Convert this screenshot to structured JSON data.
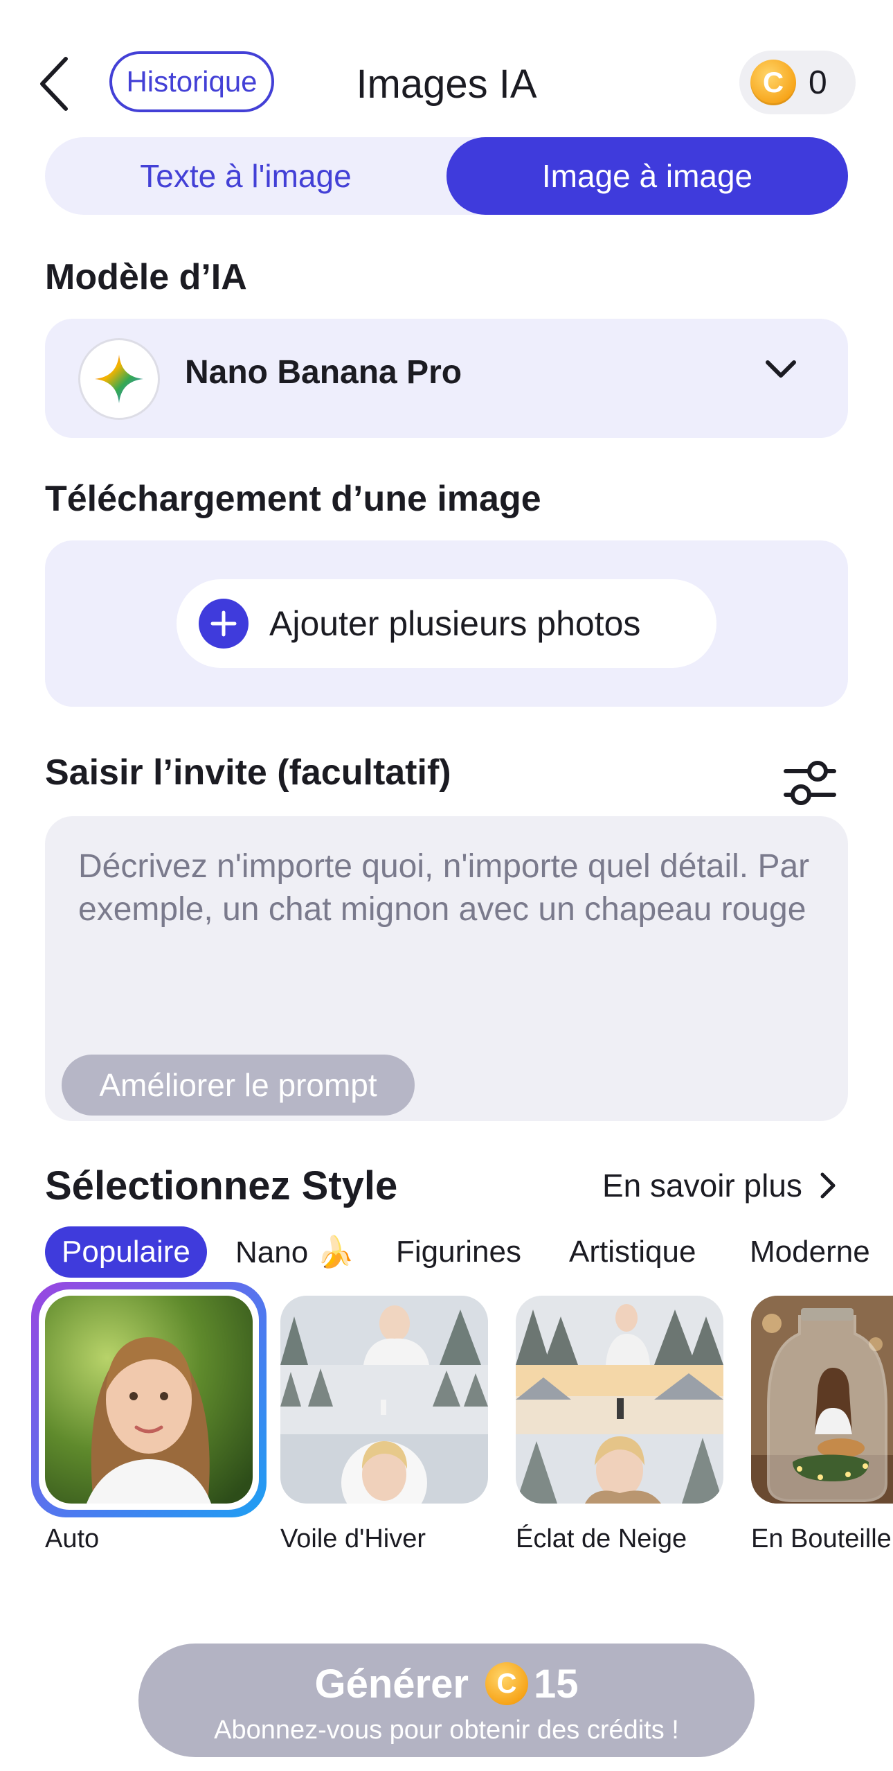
{
  "header": {
    "back_icon": "chevron-left-icon",
    "history_label": "Historique",
    "title": "Images IA",
    "coin_glyph": "C",
    "credits": "0"
  },
  "tabs": [
    {
      "label": "Texte à l'image",
      "active": false
    },
    {
      "label": "Image à image",
      "active": true
    }
  ],
  "model": {
    "section_label": "Modèle d’IA",
    "name": "Nano Banana Pro",
    "icon": "sparkle-icon"
  },
  "upload": {
    "section_label": "Téléchargement d’une image",
    "button_label": "Ajouter plusieurs photos"
  },
  "prompt": {
    "section_label": "Saisir l’invite (facultatif)",
    "placeholder": "Décrivez n'importe quoi, n'importe quel détail. Par exemple, un chat mignon avec un chapeau rouge",
    "value": "",
    "improve_label": "Améliorer le prompt"
  },
  "style": {
    "title": "Sélectionnez Style",
    "learn_more": "En savoir plus",
    "categories": [
      "Populaire",
      "Nano 🍌",
      "Figurines",
      "Artistique",
      "Moderne"
    ],
    "active_category": "Populaire",
    "items": [
      {
        "name": "Auto",
        "selected": true
      },
      {
        "name": "Voile d'Hiver",
        "selected": false
      },
      {
        "name": "Éclat de Neige",
        "selected": false
      },
      {
        "name": "En Bouteille",
        "selected": false
      }
    ]
  },
  "generate": {
    "label": "Générer",
    "coin_glyph": "C",
    "cost": "15",
    "subtitle": "Abonnez-vous pour obtenir des crédits !"
  },
  "colors": {
    "accent": "#3f3bdc",
    "panel": "#eeeefc",
    "disabled": "#b3b3c3",
    "coin": "#f7a51a"
  }
}
